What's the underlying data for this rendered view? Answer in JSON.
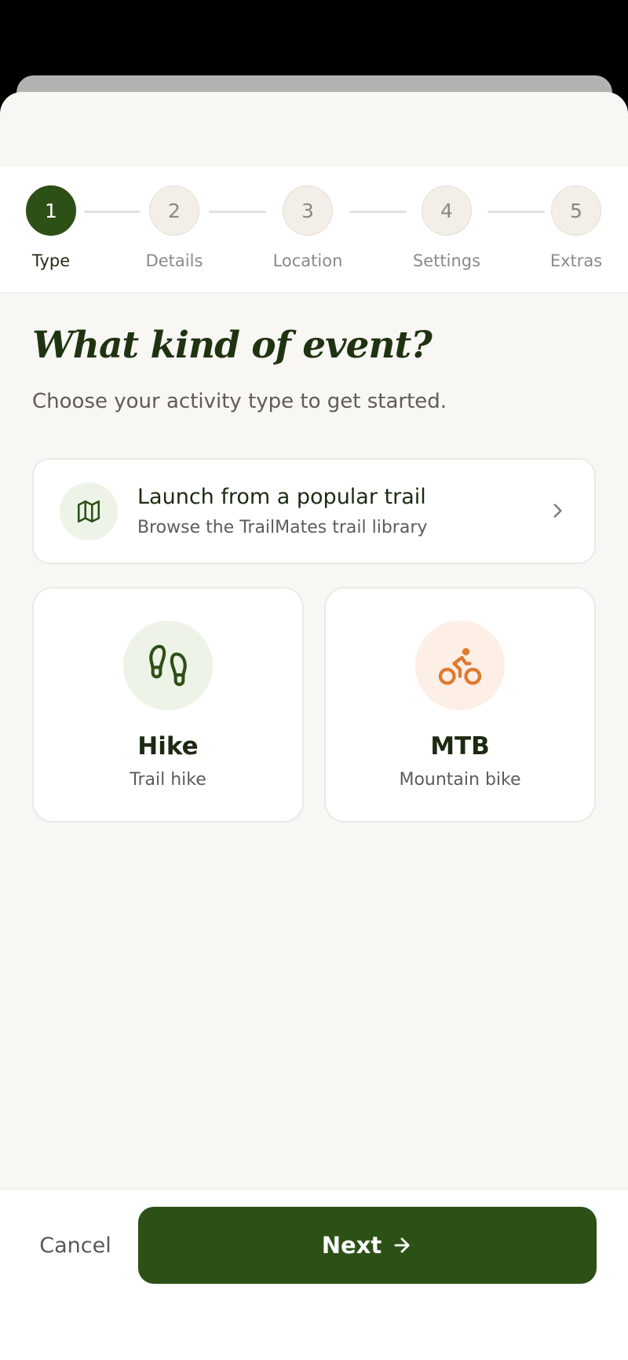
{
  "stepper": {
    "steps": [
      {
        "number": "1",
        "label": "Type",
        "active": true
      },
      {
        "number": "2",
        "label": "Details",
        "active": false
      },
      {
        "number": "3",
        "label": "Location",
        "active": false
      },
      {
        "number": "4",
        "label": "Settings",
        "active": false
      },
      {
        "number": "5",
        "label": "Extras",
        "active": false
      }
    ]
  },
  "main": {
    "title": "What kind of event?",
    "subtitle": "Choose your activity type to get started."
  },
  "trail_card": {
    "title": "Launch from a popular trail",
    "subtitle": "Browse the TrailMates trail library",
    "icon": "map-icon"
  },
  "activities": [
    {
      "name": "Hike",
      "description": "Trail hike",
      "icon": "footprints-icon",
      "color": "#2d5016",
      "bg": "#edf3e6"
    },
    {
      "name": "MTB",
      "description": "Mountain bike",
      "icon": "bicycle-icon",
      "color": "#e07a2f",
      "bg": "#fdeee6"
    }
  ],
  "footer": {
    "cancel_label": "Cancel",
    "next_label": "Next"
  },
  "colors": {
    "primary": "#2d5016",
    "accent_orange": "#e07a2f",
    "background": "#f8f7f4"
  }
}
